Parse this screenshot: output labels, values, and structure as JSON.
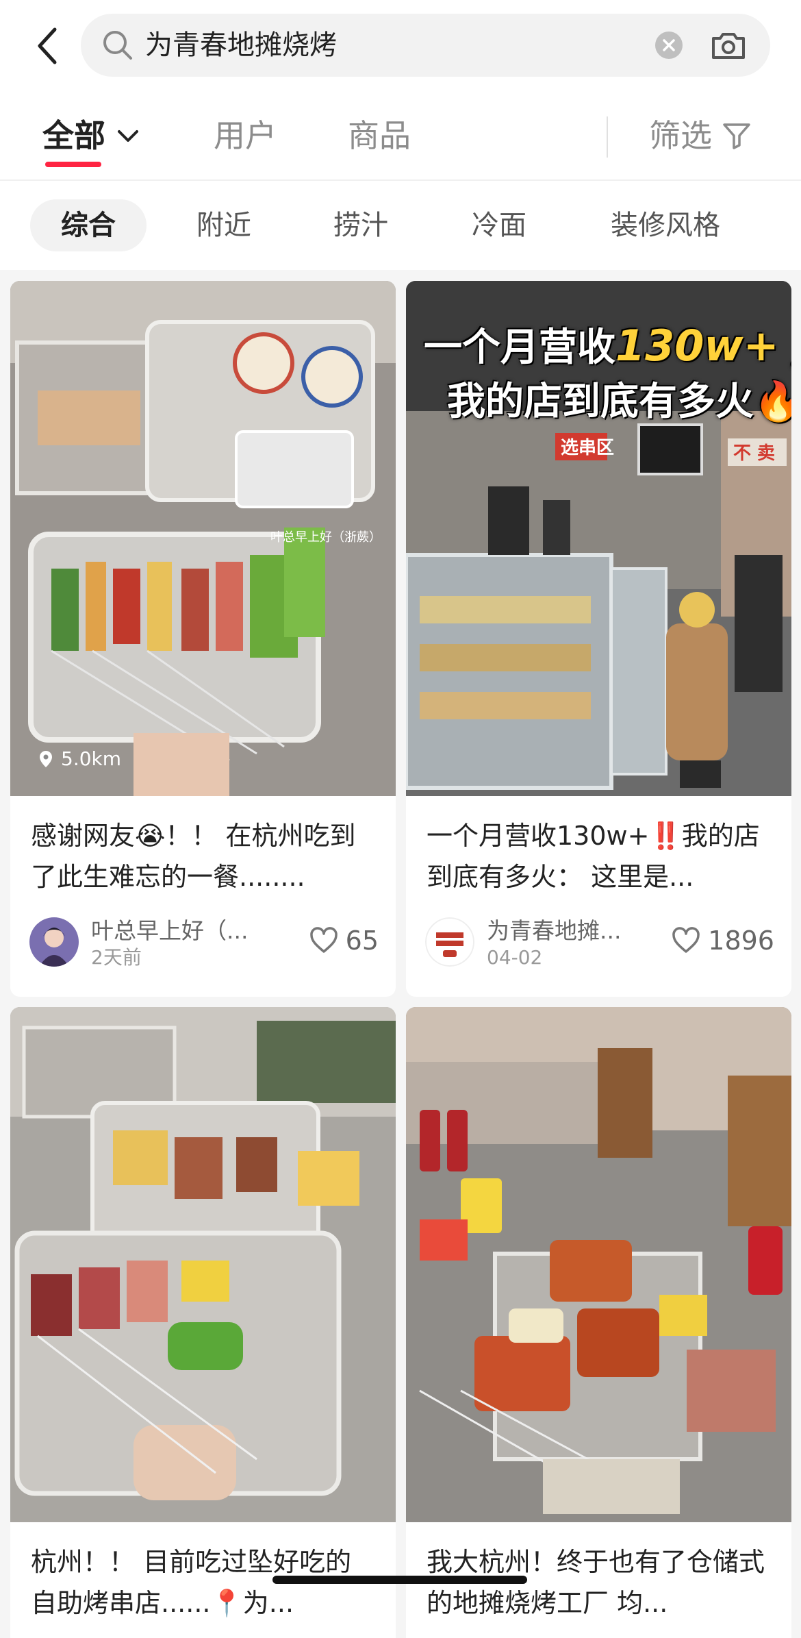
{
  "search": {
    "query": "为青春地摊烧烤"
  },
  "type_tabs": {
    "all": "全部",
    "users": "用户",
    "goods": "商品",
    "filter": "筛选"
  },
  "subcategories": [
    "综合",
    "附近",
    "捞汁",
    "冷面",
    "装修风格"
  ],
  "notes": [
    {
      "title": "感谢网友😭！！ 在杭州吃到了此生难忘的一餐........",
      "author": "叶总早上好（...",
      "date": "2天前",
      "likes": "65",
      "distance": "5.0km",
      "cover_watermark": "叶总早上好（浙蕨）"
    },
    {
      "title": "一个月营收130w+‼️我的店到底有多火： 这里是...",
      "author": "为青春地摊...",
      "date": "04-02",
      "likes": "1896",
      "cover_overlay_line1_prefix": "一个月营收",
      "cover_overlay_line1_highlight": "130w+‼️",
      "cover_overlay_line2": "我的店到底有多火🔥",
      "cover_sign_1": "选串区",
      "cover_sign_2": "不 卖"
    },
    {
      "title": "杭州！！ 目前吃过坠好吃的自助烤串店......📍为...",
      "author": "",
      "date": "",
      "likes": ""
    },
    {
      "title": "我大杭州！终于也有了仓储式的地摊烧烤工厂 均...",
      "author": "",
      "date": "",
      "likes": ""
    }
  ],
  "colors": {
    "accent": "#ff2442",
    "chip_bg": "#f2f2f2",
    "feed_bg": "#f5f5f5",
    "muted_text": "#8c8c8c"
  },
  "icons": {
    "back": "chevron-left-icon",
    "search": "search-icon",
    "clear": "clear-icon",
    "camera": "camera-icon",
    "dropdown": "chevron-down-icon",
    "filter": "funnel-icon",
    "like": "heart-icon",
    "location": "location-pin-icon"
  }
}
